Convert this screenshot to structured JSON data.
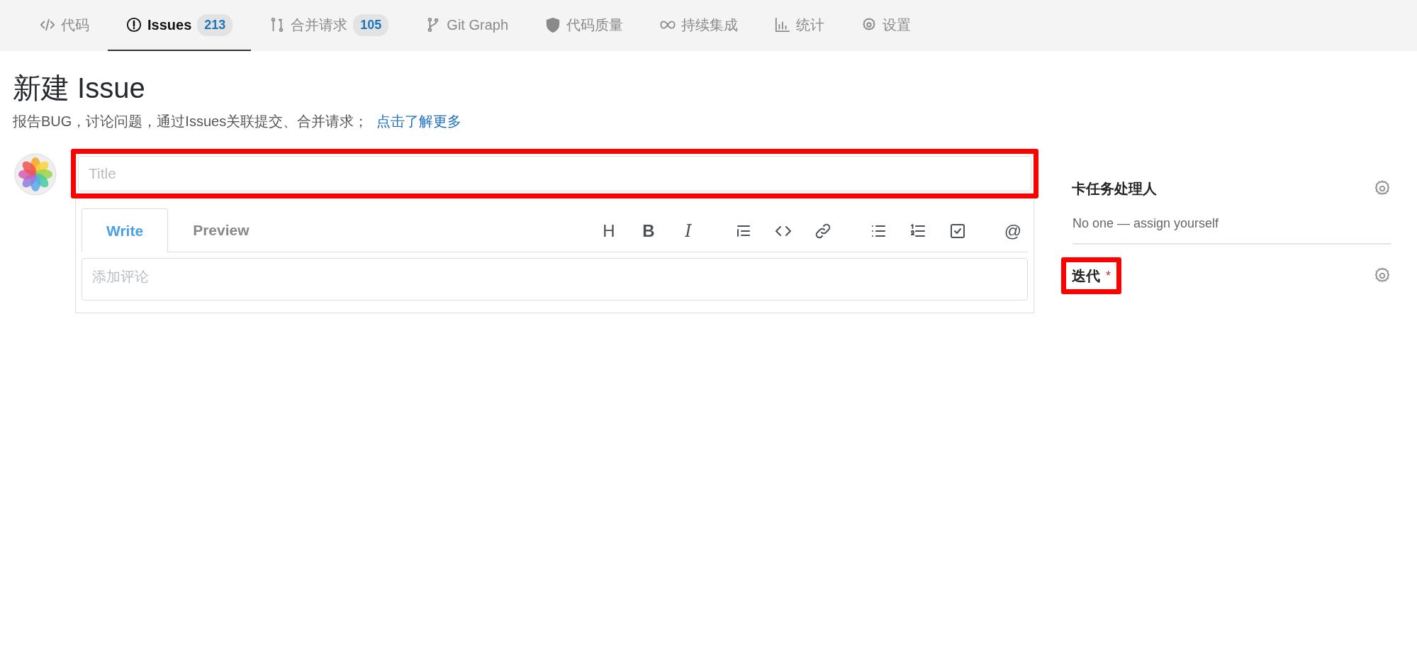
{
  "nav_tabs": [
    {
      "kind": "code",
      "label": "代码",
      "selected": false
    },
    {
      "kind": "issue",
      "label": "Issues",
      "count": "213",
      "selected": true
    },
    {
      "kind": "merge",
      "label": "合并请求",
      "count": "105",
      "selected": false
    },
    {
      "kind": "branch",
      "label": "Git Graph",
      "selected": false
    },
    {
      "kind": "shield",
      "label": "代码质量",
      "selected": false
    },
    {
      "kind": "infinity",
      "label": "持续集成",
      "selected": false
    },
    {
      "kind": "chart",
      "label": "统计",
      "selected": false
    },
    {
      "kind": "gear",
      "label": "设置",
      "selected": false
    }
  ],
  "page": {
    "title": "新建 Issue",
    "description": "报告BUG，讨论问题，通过Issues关联提交、合并请求；",
    "link": "点击了解更多"
  },
  "form": {
    "title_field": {
      "placeholder": "Title",
      "highlighted": true
    },
    "editor_tabs": [
      {
        "label": "Write",
        "selected": true
      },
      {
        "label": "Preview",
        "selected": false
      }
    ],
    "toolbar": [
      {
        "kind": "heading",
        "label": "H"
      },
      {
        "kind": "bold",
        "label": "B"
      },
      {
        "kind": "italic",
        "label": "I"
      },
      {
        "kind": "quote"
      },
      {
        "kind": "code"
      },
      {
        "kind": "link"
      },
      {
        "kind": "bullets"
      },
      {
        "kind": "numbers"
      },
      {
        "kind": "task"
      },
      {
        "kind": "mention",
        "label": "@"
      }
    ],
    "comment": {
      "placeholder": "添加评论"
    }
  },
  "sidebar": [
    {
      "title": "卡任务处理人",
      "value": "No one — assign yourself",
      "highlighted": false
    },
    {
      "title": "迭代",
      "required_mark": "*",
      "highlighted": true
    }
  ]
}
